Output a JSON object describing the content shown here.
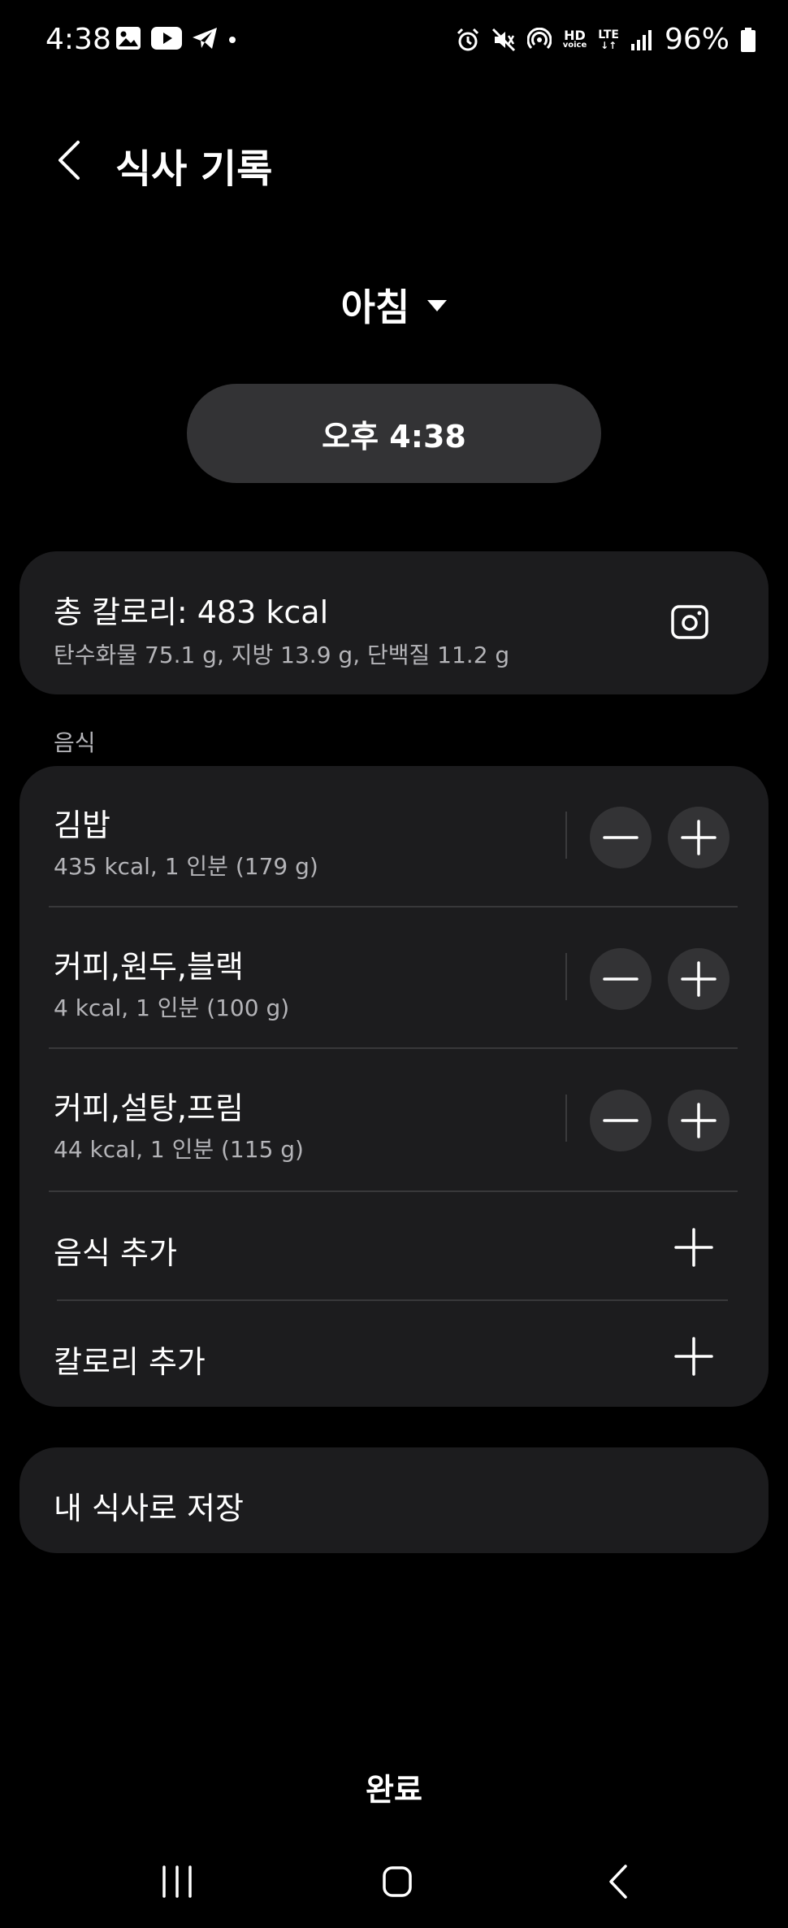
{
  "status_bar": {
    "time": "4:38",
    "battery": "96%",
    "hd_label": "HD",
    "hd_sub": "voice",
    "lte_label": "LTE"
  },
  "header": {
    "title": "식사 기록"
  },
  "meal_selector": {
    "selected": "아침"
  },
  "time_pill": {
    "value": "오후 4:38"
  },
  "summary": {
    "total_calories": "총 칼로리: 483 kcal",
    "nutrients": "탄수화물 75.1 g, 지방 13.9 g, 단백질 11.2 g"
  },
  "food_section": {
    "label": "음식",
    "items": [
      {
        "name": "김밥",
        "detail": "435 kcal, 1 인분 (179 g)"
      },
      {
        "name": "커피,원두,블랙",
        "detail": "4 kcal, 1 인분 (100 g)"
      },
      {
        "name": "커피,설탕,프림",
        "detail": "44 kcal, 1 인분 (115 g)"
      }
    ],
    "add_food_label": "음식 추가",
    "add_calorie_label": "칼로리 추가"
  },
  "save": {
    "label": "내 식사로 저장"
  },
  "done": {
    "label": "완료"
  }
}
